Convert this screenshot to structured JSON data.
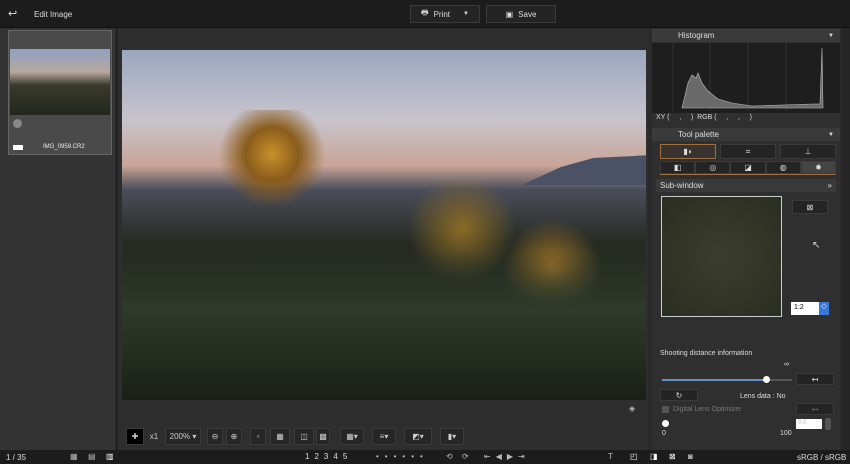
{
  "header": {
    "title": "Edit Image",
    "print_label": "Print",
    "save_label": "Save"
  },
  "filmstrip": {
    "filename": "IMG_0959.CR2",
    "counter": "1 / 35"
  },
  "toolbar": {
    "zoom_x1": "x1",
    "zoom_level": "200%"
  },
  "histogram": {
    "title": "Histogram",
    "readout": "XY (     ,     )  RGB (     ,     ,     )"
  },
  "tool_palette": {
    "title": "Tool palette",
    "subwindow_label": "Sub-window",
    "subwindow_zoom": "1:2",
    "shooting_distance": "Shooting distance information",
    "infinity": "∞",
    "slider_value": 0.8,
    "lens_data": "Lens data :  No",
    "dlo_label": "Digital Lens Optimizer",
    "dlo_min": "0",
    "dlo_max": "100",
    "dlo_value": "0.0"
  },
  "bottom": {
    "ratings": [
      "1",
      "2",
      "3",
      "4",
      "5"
    ],
    "color_space": "sRGB / sRGB"
  }
}
